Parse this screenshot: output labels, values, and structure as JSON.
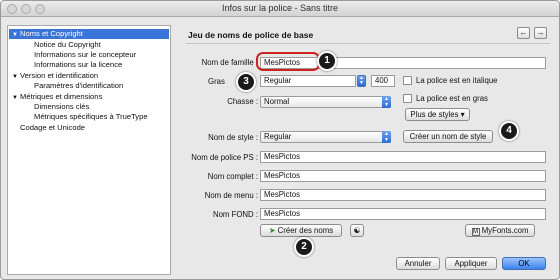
{
  "window": {
    "title": "Infos sur la police - Sans titre"
  },
  "sidebar": {
    "items": [
      {
        "label": "Noms et Copyright",
        "expanded": true,
        "selected": true
      },
      {
        "label": "Notice du Copyright"
      },
      {
        "label": "Informations sur le concepteur"
      },
      {
        "label": "Informations sur la licence"
      },
      {
        "label": "Version et identification",
        "expanded": true
      },
      {
        "label": "Paramètres d'identification"
      },
      {
        "label": "Métriques et dimensions",
        "expanded": true
      },
      {
        "label": "Dimensions clés"
      },
      {
        "label": "Métriques spécifiques à TrueType"
      },
      {
        "label": "Codage et Unicode"
      }
    ]
  },
  "panel": {
    "section_title": "Jeu de noms de police de base",
    "nav_prev": "←",
    "nav_next": "→",
    "family_label": "Nom de famille :",
    "family_value": "MesPictos",
    "weight_label": "Gras",
    "weight_value": "Regular",
    "weight_number": "400",
    "italic_label": "La police est en italique",
    "width_label": "Chasse :",
    "width_value": "Normal",
    "bold_label": "La police est en gras",
    "more_styles": "Plus de styles",
    "style_label": "Nom de style :",
    "style_value": "Regular",
    "create_style_button": "Créer un nom de style",
    "ps_label": "Nom de police PS :",
    "ps_value": "MesPictos",
    "full_label": "Nom complet :",
    "full_value": "MesPictos",
    "menu_label": "Nom de menu :",
    "menu_value": "MesPictos",
    "fond_label": "Nom FOND :",
    "fond_value": "MesPictos",
    "create_names_button": "Créer des noms",
    "myfonts_button": "MyFonts.com"
  },
  "footer": {
    "cancel": "Annuler",
    "apply": "Appliquer",
    "ok": "OK"
  },
  "callouts": [
    "1",
    "2",
    "3",
    "4"
  ],
  "colors": {
    "selection": "#3875d7",
    "default_button": "#3c82ec",
    "highlight": "#cc2222"
  }
}
